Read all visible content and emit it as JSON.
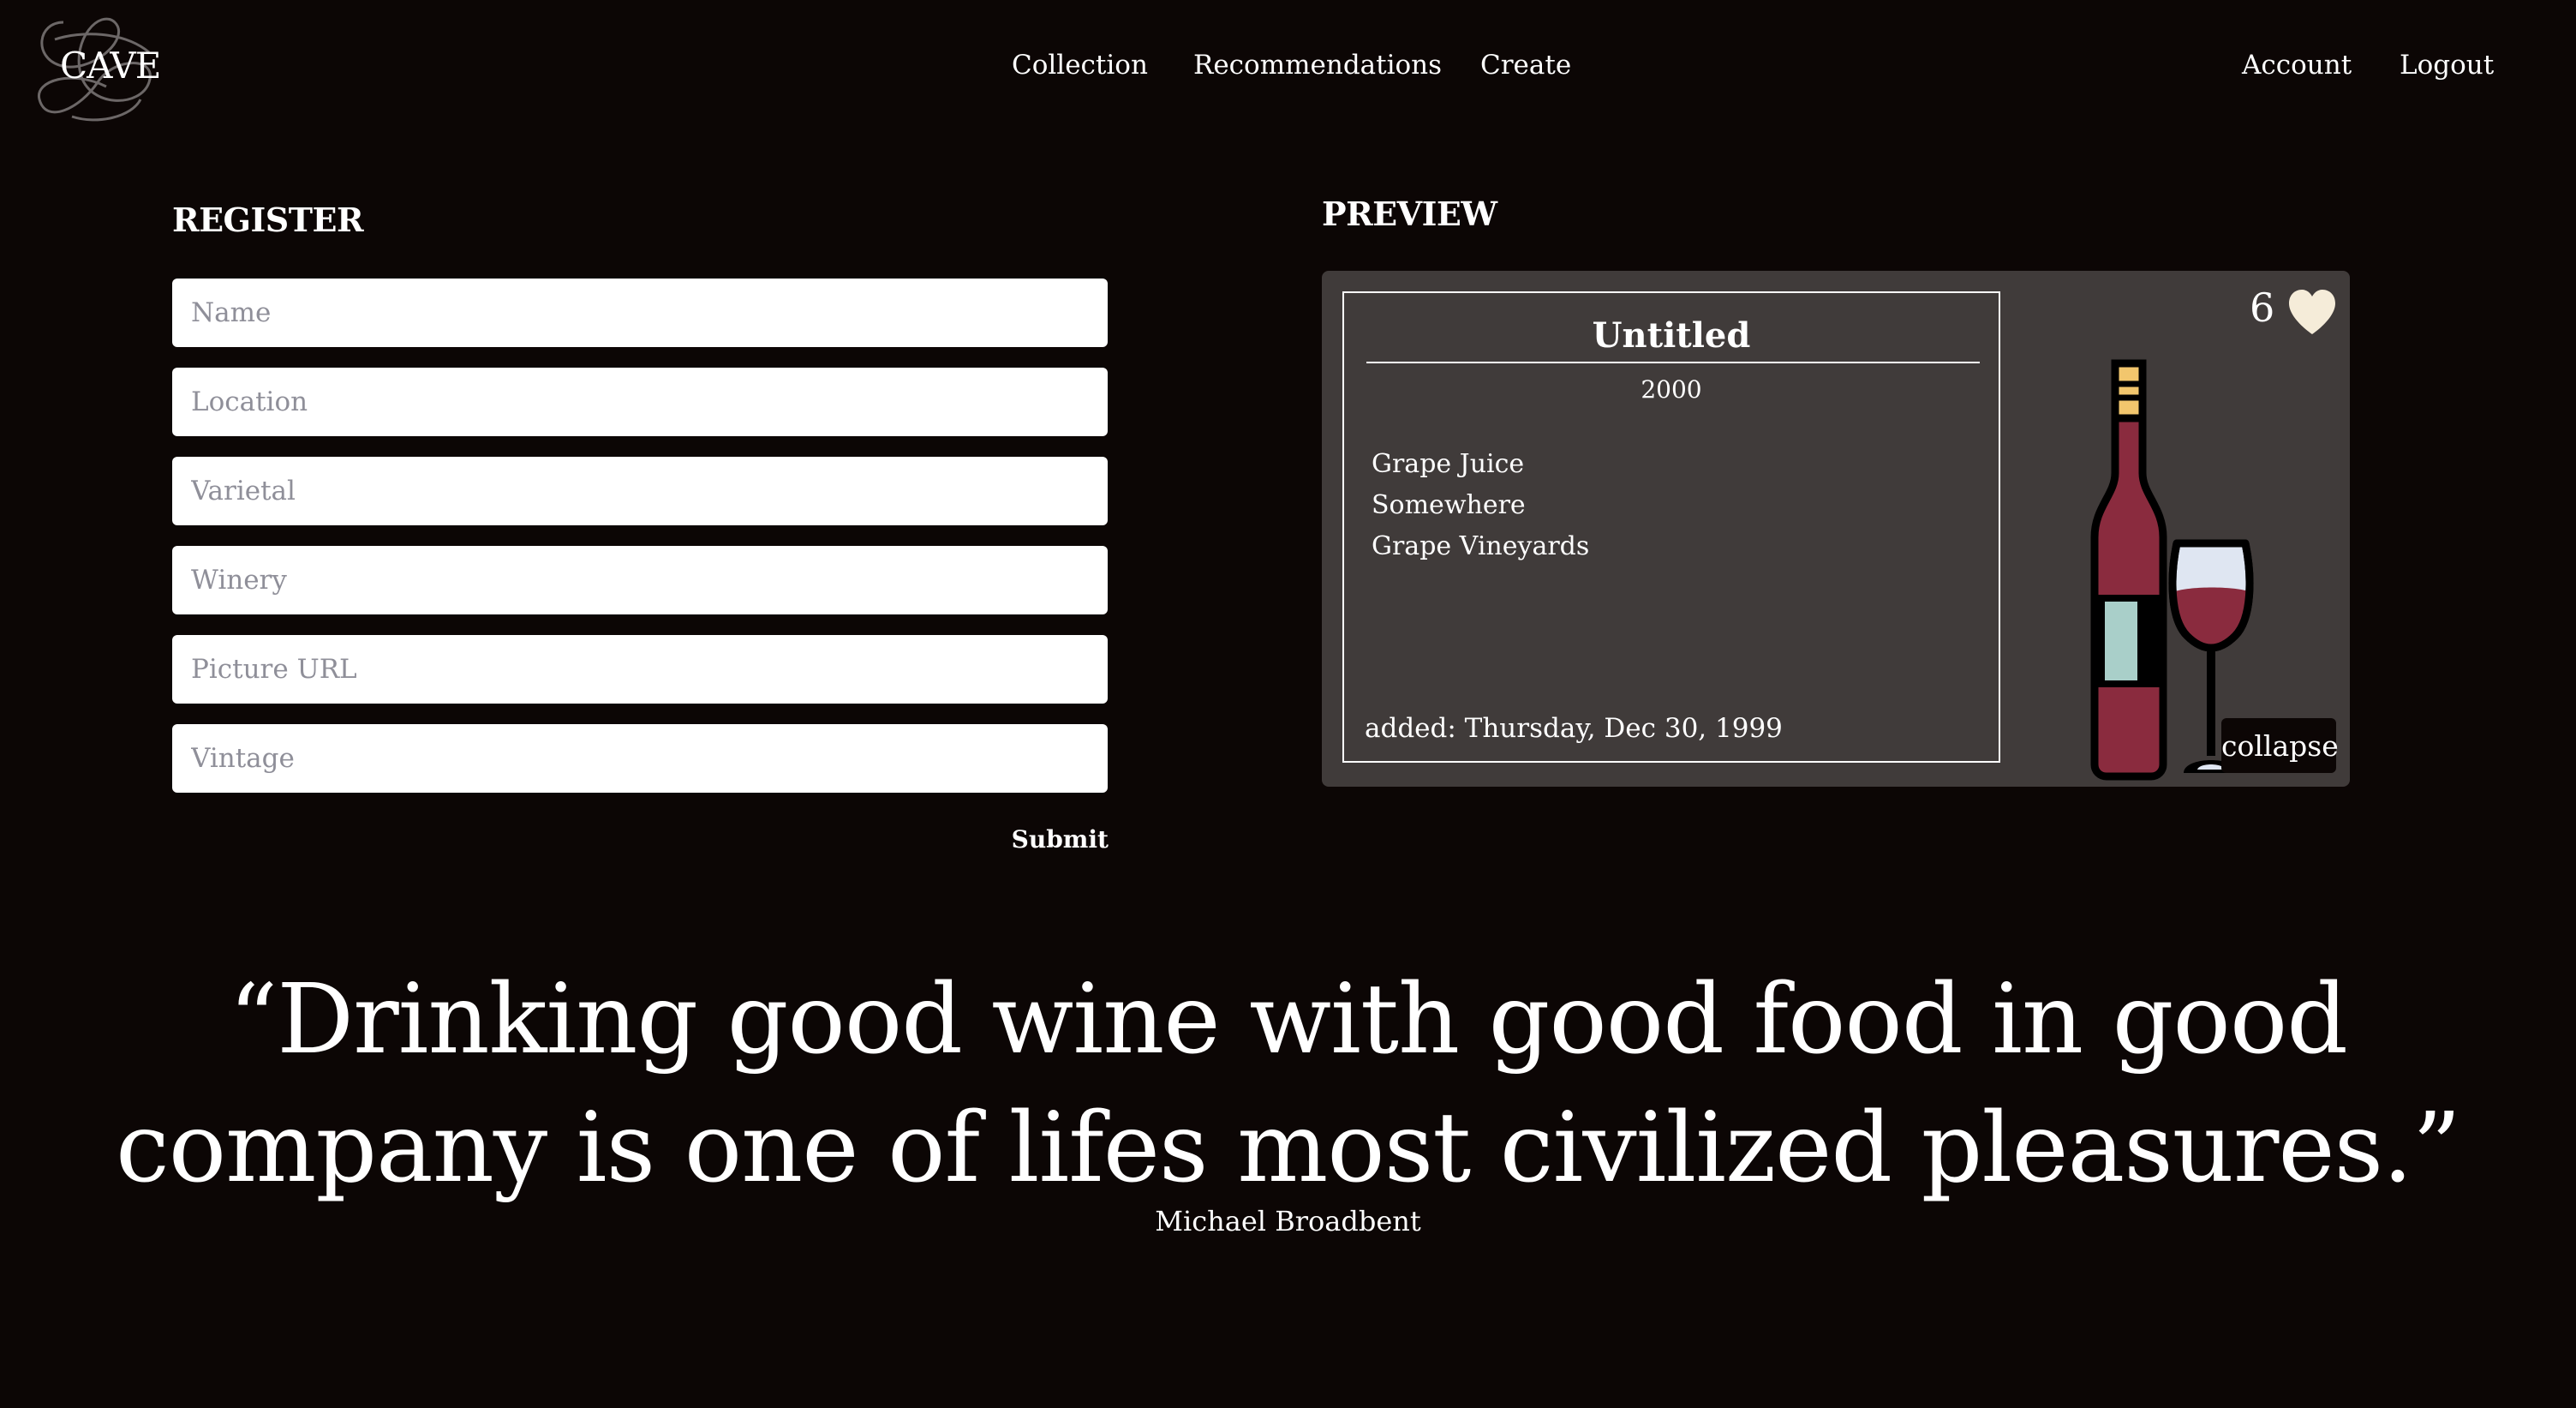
{
  "header": {
    "brand": "CAVE",
    "nav": {
      "collection": "Collection",
      "recommendations": "Recommendations",
      "create": "Create"
    },
    "account": "Account",
    "logout": "Logout"
  },
  "register": {
    "heading": "REGISTER",
    "fields": {
      "name": "Name",
      "location": "Location",
      "varietal": "Varietal",
      "winery": "Winery",
      "picture_url": "Picture URL",
      "vintage": "Vintage"
    },
    "submit": "Submit"
  },
  "preview": {
    "heading": "PREVIEW",
    "card": {
      "title": "Untitled",
      "vintage": "2000",
      "varietal": "Grape Juice",
      "location": "Somewhere",
      "winery": "Grape Vineyards",
      "added": "added: Thursday, Dec 30, 1999",
      "likes": "6",
      "collapse": "collapse"
    }
  },
  "quote": {
    "text": "“Drinking good wine with good food in good company is one of lifes most civilized pleasures.”",
    "author": "Michael Broadbent"
  },
  "colors": {
    "background": "#0c0605",
    "card": "#403b3a",
    "wine": "#8a2b3e",
    "heart": "#f5ecd9"
  }
}
